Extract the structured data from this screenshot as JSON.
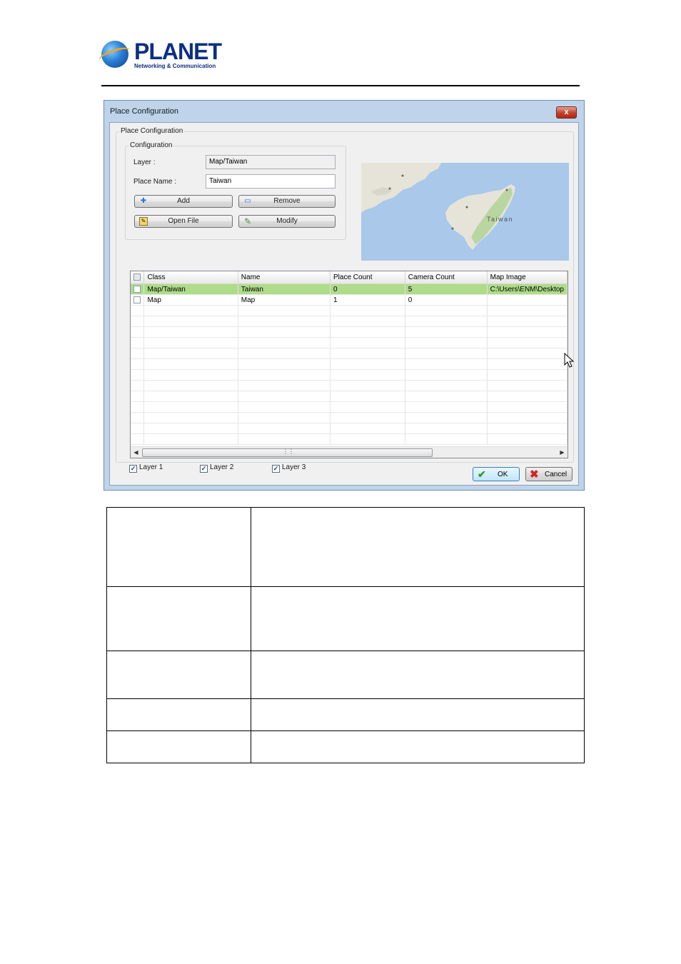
{
  "header": {
    "brand": "PLANET",
    "tagline": "Networking & Communication"
  },
  "dialog": {
    "title": "Place Configuration",
    "close_label": "x",
    "outer_group_label": "Place Configuration",
    "config_group_label": "Configuration",
    "layer_label": "Layer :",
    "layer_value": "Map/Taiwan",
    "place_name_label": "Place Name :",
    "place_name_value": "Taiwan",
    "buttons": {
      "add": "Add",
      "remove": "Remove",
      "open_file": "Open File",
      "modify": "Modify",
      "ok": "OK",
      "cancel": "Cancel"
    },
    "map": {
      "country_label": "Taiwan",
      "colors": {
        "sea": "#a9c8ea",
        "land": "#e6e4d8",
        "forest": "#b9d5a0"
      }
    },
    "grid": {
      "columns": [
        "Class",
        "Name",
        "Place Count",
        "Camera Count",
        "Map Image"
      ],
      "rows": [
        {
          "class": "Map/Taiwan",
          "name": "Taiwan",
          "place_count": "0",
          "camera_count": "5",
          "map_image": "C:\\Users\\ENM\\Desktop",
          "selected": true
        },
        {
          "class": "Map",
          "name": "Map",
          "place_count": "1",
          "camera_count": "0",
          "map_image": "",
          "selected": false
        }
      ],
      "selection_color": "#aedc88"
    },
    "layers": [
      {
        "label": "Layer 1",
        "checked": true
      },
      {
        "label": "Layer 2",
        "checked": true
      },
      {
        "label": "Layer 3",
        "checked": true
      }
    ]
  }
}
